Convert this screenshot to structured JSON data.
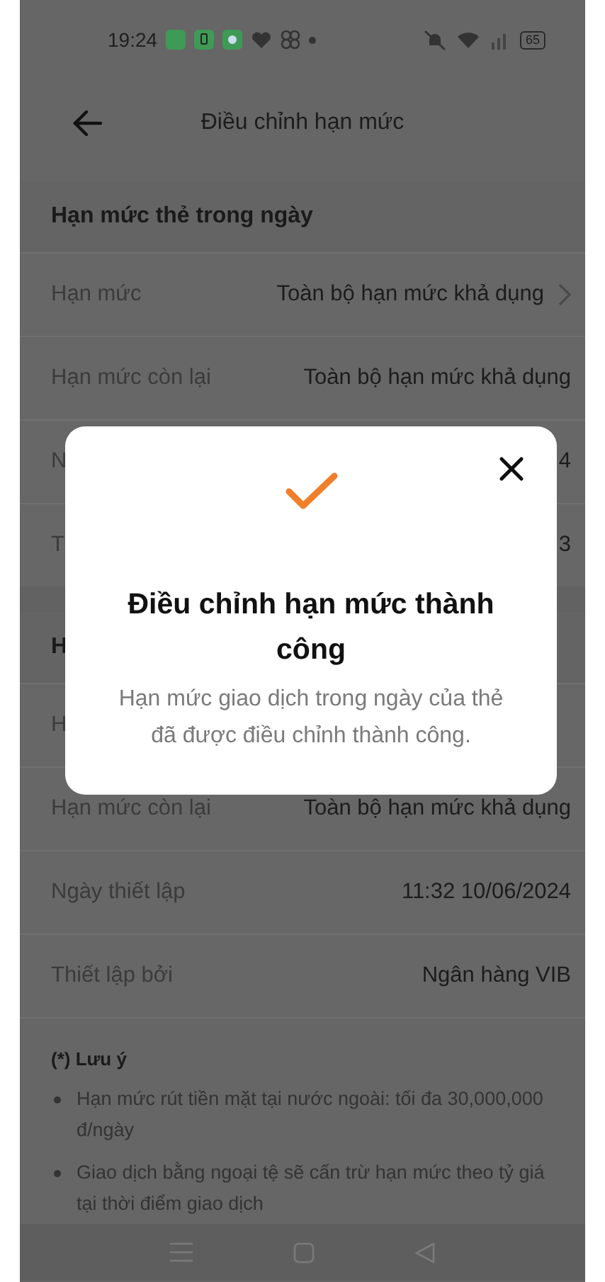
{
  "status_bar": {
    "time": "19:24",
    "battery": "65"
  },
  "header": {
    "title": "Điều chỉnh hạn mức"
  },
  "sections": [
    {
      "title": "Hạn mức thẻ trong ngày",
      "rows": [
        {
          "label": "Hạn mức",
          "value": "Toàn bộ hạn mức khả dụng",
          "has_chevron": true
        },
        {
          "label": "Hạn mức còn lại",
          "value": "Toàn bộ hạn mức khả dụng",
          "has_chevron": false
        },
        {
          "label": "N",
          "value": "4",
          "has_chevron": false
        },
        {
          "label": "T",
          "value": "3",
          "has_chevron": false
        }
      ]
    },
    {
      "title": "H",
      "rows": [
        {
          "label": "H",
          "has_chevron": false
        },
        {
          "label": "Hạn mức còn lại",
          "value": "Toàn bộ hạn mức khả dụng",
          "has_chevron": false
        },
        {
          "label": "Ngày thiết lập",
          "value": "11:32 10/06/2024",
          "has_chevron": false
        },
        {
          "label": "Thiết lập bởi",
          "value": "Ngân hàng VIB",
          "has_chevron": false
        }
      ]
    }
  ],
  "notes": {
    "title": "(*) Lưu ý",
    "items": [
      "Hạn mức rút tiền mặt tại nước ngoài: tối đa 30,000,000 đ/ngày",
      "Giao dịch bằng ngoại tệ sẽ cấn trừ hạn mức theo tỷ giá tại thời điểm giao dịch"
    ]
  },
  "dialog": {
    "title": "Điều chỉnh hạn mức thành công",
    "message": "Hạn mức giao dịch trong ngày của thẻ đã được điều chỉnh thành công."
  }
}
